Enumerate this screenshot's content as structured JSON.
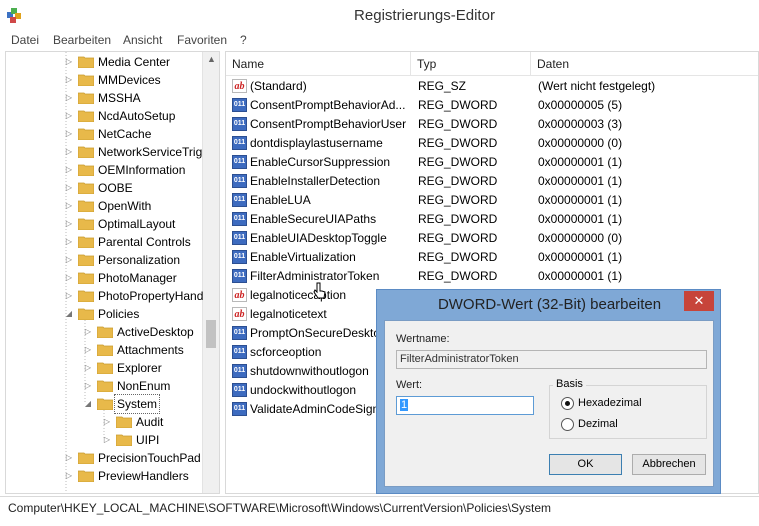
{
  "window": {
    "title": "Registrierungs-Editor"
  },
  "menu": [
    "Datei",
    "Bearbeiten",
    "Ansicht",
    "Favoriten",
    "?"
  ],
  "tree": {
    "items": [
      {
        "label": "Media Center",
        "level": 1
      },
      {
        "label": "MMDevices",
        "level": 1
      },
      {
        "label": "MSSHA",
        "level": 1
      },
      {
        "label": "NcdAutoSetup",
        "level": 1
      },
      {
        "label": "NetCache",
        "level": 1
      },
      {
        "label": "NetworkServiceTrig",
        "level": 1
      },
      {
        "label": "OEMInformation",
        "level": 1
      },
      {
        "label": "OOBE",
        "level": 1
      },
      {
        "label": "OpenWith",
        "level": 1
      },
      {
        "label": "OptimalLayout",
        "level": 1
      },
      {
        "label": "Parental Controls",
        "level": 1
      },
      {
        "label": "Personalization",
        "level": 1
      },
      {
        "label": "PhotoManager",
        "level": 1
      },
      {
        "label": "PhotoPropertyHand",
        "level": 1
      },
      {
        "label": "Policies",
        "level": 1,
        "expanded": true
      },
      {
        "label": "ActiveDesktop",
        "level": 2
      },
      {
        "label": "Attachments",
        "level": 2
      },
      {
        "label": "Explorer",
        "level": 2
      },
      {
        "label": "NonEnum",
        "level": 2
      },
      {
        "label": "System",
        "level": 2,
        "expanded": true,
        "selected": true
      },
      {
        "label": "Audit",
        "level": 3
      },
      {
        "label": "UIPI",
        "level": 3
      },
      {
        "label": "PrecisionTouchPad",
        "level": 1
      },
      {
        "label": "PreviewHandlers",
        "level": 1
      }
    ]
  },
  "list": {
    "columns": [
      "Name",
      "Typ",
      "Daten"
    ],
    "rows": [
      {
        "icon": "string-value-icon",
        "name": "(Standard)",
        "type": "REG_SZ",
        "data": "(Wert nicht festgelegt)"
      },
      {
        "icon": "dword-value-icon",
        "name": "ConsentPromptBehaviorAd...",
        "type": "REG_DWORD",
        "data": "0x00000005 (5)"
      },
      {
        "icon": "dword-value-icon",
        "name": "ConsentPromptBehaviorUser",
        "type": "REG_DWORD",
        "data": "0x00000003 (3)"
      },
      {
        "icon": "dword-value-icon",
        "name": "dontdisplaylastusername",
        "type": "REG_DWORD",
        "data": "0x00000000 (0)"
      },
      {
        "icon": "dword-value-icon",
        "name": "EnableCursorSuppression",
        "type": "REG_DWORD",
        "data": "0x00000001 (1)"
      },
      {
        "icon": "dword-value-icon",
        "name": "EnableInstallerDetection",
        "type": "REG_DWORD",
        "data": "0x00000001 (1)"
      },
      {
        "icon": "dword-value-icon",
        "name": "EnableLUA",
        "type": "REG_DWORD",
        "data": "0x00000001 (1)"
      },
      {
        "icon": "dword-value-icon",
        "name": "EnableSecureUIAPaths",
        "type": "REG_DWORD",
        "data": "0x00000001 (1)"
      },
      {
        "icon": "dword-value-icon",
        "name": "EnableUIADesktopToggle",
        "type": "REG_DWORD",
        "data": "0x00000000 (0)"
      },
      {
        "icon": "dword-value-icon",
        "name": "EnableVirtualization",
        "type": "REG_DWORD",
        "data": "0x00000001 (1)"
      },
      {
        "icon": "dword-value-icon",
        "name": "FilterAdministratorToken",
        "type": "REG_DWORD",
        "data": "0x00000001 (1)"
      },
      {
        "icon": "string-value-icon",
        "name": "legalnoticecaption",
        "type": "",
        "data": ""
      },
      {
        "icon": "string-value-icon",
        "name": "legalnoticetext",
        "type": "",
        "data": ""
      },
      {
        "icon": "dword-value-icon",
        "name": "PromptOnSecureDesktop",
        "type": "",
        "data": ""
      },
      {
        "icon": "dword-value-icon",
        "name": "scforceoption",
        "type": "",
        "data": ""
      },
      {
        "icon": "dword-value-icon",
        "name": "shutdownwithoutlogon",
        "type": "",
        "data": ""
      },
      {
        "icon": "dword-value-icon",
        "name": "undockwithoutlogon",
        "type": "",
        "data": ""
      },
      {
        "icon": "dword-value-icon",
        "name": "ValidateAdminCodeSignatures",
        "type": "",
        "data": ""
      }
    ]
  },
  "status": {
    "path": "Computer\\HKEY_LOCAL_MACHINE\\SOFTWARE\\Microsoft\\Windows\\CurrentVersion\\Policies\\System"
  },
  "dialog": {
    "title": "DWORD-Wert (32-Bit) bearbeiten",
    "close": "✕",
    "name_label": "Wertname:",
    "name_value": "FilterAdministratorToken",
    "value_label": "Wert:",
    "value": "1",
    "base_label": "Basis",
    "radio_hex": "Hexadezimal",
    "radio_dec": "Dezimal",
    "base_selected": "Hexadezimal",
    "ok": "OK",
    "cancel": "Abbrechen"
  },
  "colors": {
    "folder": "#e8b94a",
    "dialog_frame": "#7fa8d6",
    "close_button": "#c7443a",
    "dword_icon": "#3d6bbf"
  }
}
